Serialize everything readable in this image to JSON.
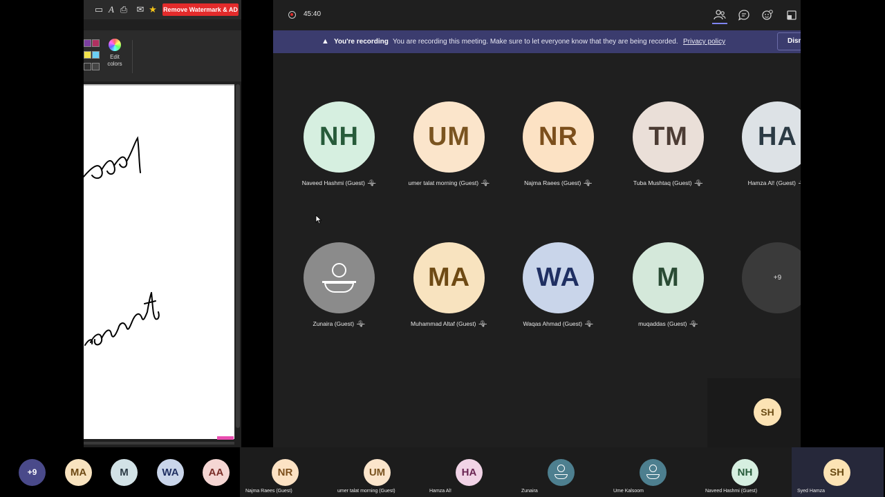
{
  "paint": {
    "remove_watermark_label": "Remove Watermark & AD",
    "edit_colors_line1": "Edit",
    "edit_colors_line2": "colors",
    "canvas_text_1": "ael",
    "canvas_text_2": "ounts"
  },
  "meeting": {
    "timer": "45:40",
    "banner": {
      "title": "You're recording",
      "message": "You are recording this meeting. Make sure to let everyone know that they are being recorded.",
      "link": "Privacy policy",
      "dismiss": "Dismiss"
    },
    "participants": [
      {
        "initials": "NH",
        "name": "Naveed Hashmi (Guest)",
        "bg": "#d6efe0",
        "fg": "#275b3a"
      },
      {
        "initials": "UM",
        "name": "umer talat morning (Guest)",
        "bg": "#fbe5cb",
        "fg": "#7a5420"
      },
      {
        "initials": "NR",
        "name": "Najma Raees (Guest)",
        "bg": "#fce2c4",
        "fg": "#7c4f1c"
      },
      {
        "initials": "TM",
        "name": "Tuba Mushtaq (Guest)",
        "bg": "#eadfd8",
        "fg": "#4c3c34"
      },
      {
        "initials": "HA",
        "name": "Hamza Al! (Guest)",
        "bg": "#dde2e6",
        "fg": "#2b3a44"
      },
      {
        "initials": "",
        "name": "Zunaira (Guest)",
        "bg": "#8b8b8b",
        "fg": "#ffffff"
      },
      {
        "initials": "MA",
        "name": "Muhammad Altaf (Guest)",
        "bg": "#f8e3bf",
        "fg": "#6e4a14"
      },
      {
        "initials": "WA",
        "name": "Waqas Ahmad (Guest)",
        "bg": "#c9d5ea",
        "fg": "#1f2f62"
      },
      {
        "initials": "M",
        "name": "muqaddas (Guest)",
        "bg": "#d4e8da",
        "fg": "#2a4b34"
      }
    ],
    "more_count": "+9",
    "self_initials": "SH"
  },
  "strip": {
    "small": [
      {
        "initials": "+9",
        "bg": "#4a4a8a",
        "fg": "#ffffff"
      },
      {
        "initials": "MA",
        "bg": "#f8e3bf",
        "fg": "#6e4a14"
      },
      {
        "initials": "M",
        "bg": "#d2e2e6",
        "fg": "#2b3a44"
      },
      {
        "initials": "WA",
        "bg": "#c9d5ea",
        "fg": "#1f2f62"
      },
      {
        "initials": "AA",
        "bg": "#f5d6d3",
        "fg": "#7a2d27"
      }
    ],
    "tiles": [
      {
        "initials": "NR",
        "name": "Najma Raees (Guest)",
        "bg": "#fce2c4",
        "fg": "#7c4f1c"
      },
      {
        "initials": "UM",
        "name": "umer talat morning (Guest)",
        "bg": "#fbe5cb",
        "fg": "#7a5420"
      },
      {
        "initials": "HA",
        "name": "Hamza Al!",
        "bg": "#f1d3e6",
        "fg": "#6a2452"
      },
      {
        "initials": "",
        "name": "Zunaira",
        "bg": "#4d7f8f",
        "fg": "#ffffff"
      },
      {
        "initials": "",
        "name": "Ume Kalsoom",
        "bg": "#4d7f8f",
        "fg": "#ffffff"
      },
      {
        "initials": "NH",
        "name": "Naveed Hashmi (Guest)",
        "bg": "#d6efe0",
        "fg": "#275b3a"
      },
      {
        "initials": "SH",
        "name": "Syed Hamza",
        "bg": "#fce3b4",
        "fg": "#6b4c14"
      }
    ]
  }
}
